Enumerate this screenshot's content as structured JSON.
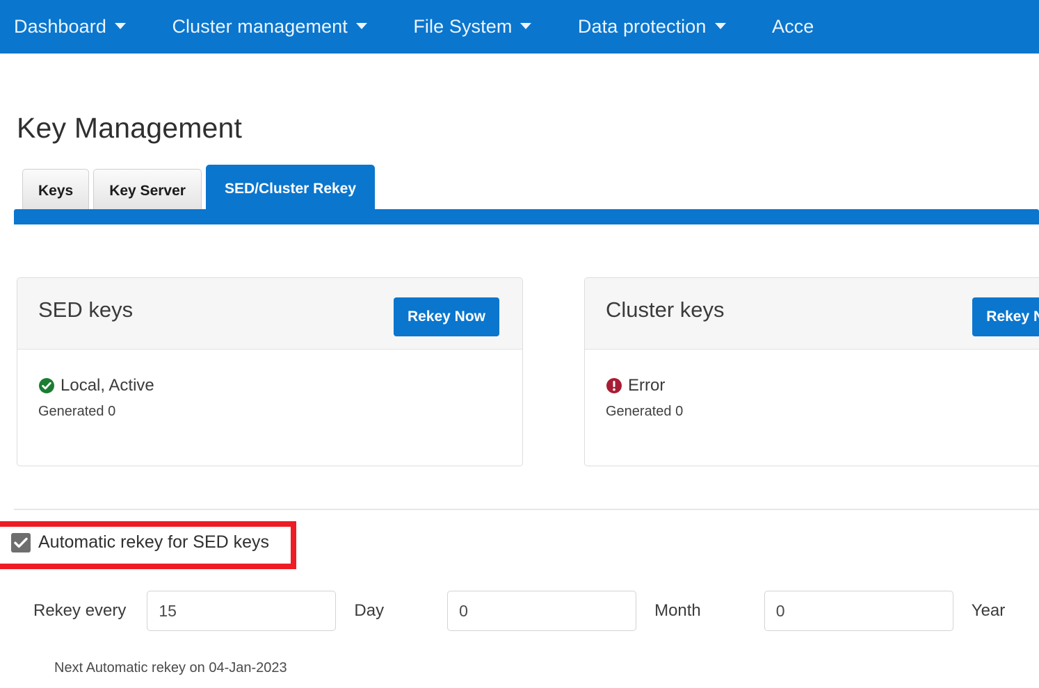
{
  "navbar": {
    "background": "#0a76ce",
    "items": [
      {
        "label": "Dashboard",
        "has_caret": true
      },
      {
        "label": "Cluster management",
        "has_caret": true
      },
      {
        "label": "File System",
        "has_caret": true
      },
      {
        "label": "Data protection",
        "has_caret": true
      },
      {
        "label": "Acce",
        "has_caret": false
      }
    ]
  },
  "page": {
    "title": "Key Management"
  },
  "tabs": [
    {
      "label": "Keys",
      "active": false
    },
    {
      "label": "Key Server",
      "active": false
    },
    {
      "label": "SED/Cluster Rekey",
      "active": true
    }
  ],
  "cards": {
    "sed": {
      "title": "SED keys",
      "button_label": "Rekey Now",
      "status_icon": "check-circle-icon",
      "status_color": "#1a7d32",
      "status_text": "Local, Active",
      "generated_text": "Generated 0"
    },
    "cluster": {
      "title": "Cluster keys",
      "button_label": "Rekey No",
      "status_icon": "error-circle-icon",
      "status_color": "#a81c34",
      "status_text": "Error",
      "generated_text": "Generated 0"
    }
  },
  "auto_rekey": {
    "checkbox_label": "Automatic rekey for SED keys",
    "checked": true,
    "highlight_color": "#ee1c24"
  },
  "interval": {
    "lead_label": "Rekey every",
    "day_value": "15",
    "day_label": "Day",
    "month_value": "0",
    "month_label": "Month",
    "year_value": "0",
    "year_label": "Year",
    "next_rekey_text": "Next Automatic rekey on 04-Jan-2023"
  }
}
